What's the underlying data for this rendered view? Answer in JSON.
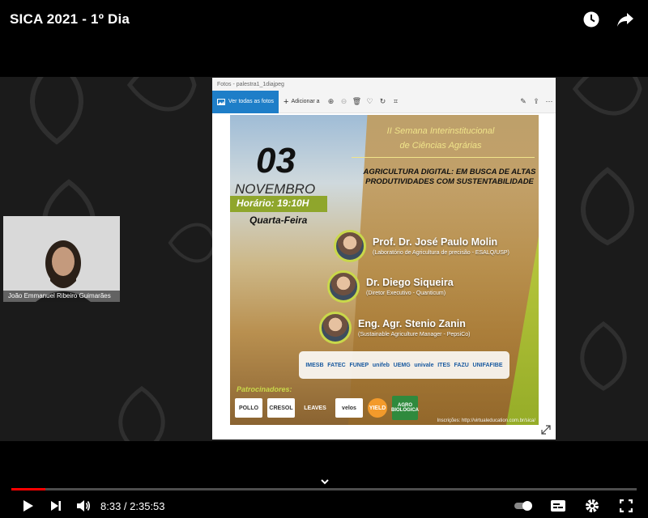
{
  "video": {
    "title": "SICA 2021 - 1º Dia",
    "current_time": "8:33",
    "duration": "2:35:53",
    "time_display": "8:33 / 2:35:53",
    "progress_fraction": 0.055
  },
  "colors": {
    "progress": "#ff0000",
    "accent_green": "#8fa62c",
    "photos_blue": "#1e7ec8"
  },
  "icons": [
    "clock-icon",
    "share-icon",
    "play-icon",
    "next-icon",
    "volume-icon",
    "chevron-down-icon",
    "autoplay-toggle-icon",
    "subtitles-icon",
    "settings-icon",
    "fullscreen-icon"
  ],
  "webcam": {
    "name": "João Emmanuel Ribeiro Guimarães"
  },
  "photos_app": {
    "titlebar": "Fotos - palestra1_1diajpeg",
    "view_all": "Ver todas as fotos",
    "add_to": "Adicionar a"
  },
  "poster": {
    "day": "03",
    "month": "NOVEMBRO",
    "time": "Horário: 19:10H",
    "weekday": "Quarta-Feira",
    "event_line1": "II Semana Interinstitucional",
    "event_line2": "de Ciências Agrárias",
    "theme": "AGRICULTURA DIGITAL: EM BUSCA DE ALTAS PRODUTIVIDADES COM SUSTENTABILIDADE",
    "speakers": [
      {
        "name": "Prof. Dr. José Paulo Molin",
        "role": "(Laboratório de Agricultura de precisão - ESALQ/USP)"
      },
      {
        "name": "Dr. Diego Siqueira",
        "role": "(Diretor Executivo - Quanticum)"
      },
      {
        "name": "Eng. Agr. Stenio Zanin",
        "role": "(Sustainable Agriculture Manager - PepsiCo)"
      }
    ],
    "partners": [
      "IMESB",
      "FATEC",
      "FUNEP",
      "unifeb",
      "UEMG",
      "univale",
      "ITES",
      "FAZU",
      "UNIFAFIBE"
    ],
    "sponsors_title": "Patrocinadores:",
    "sponsors": [
      "POLLO",
      "CRESOL",
      "LEAVES",
      "velos",
      "YIELD",
      "AGRO BIOLÓGICA"
    ],
    "registration": "Inscrições: http://virtualeducation.com.br/sica/"
  }
}
